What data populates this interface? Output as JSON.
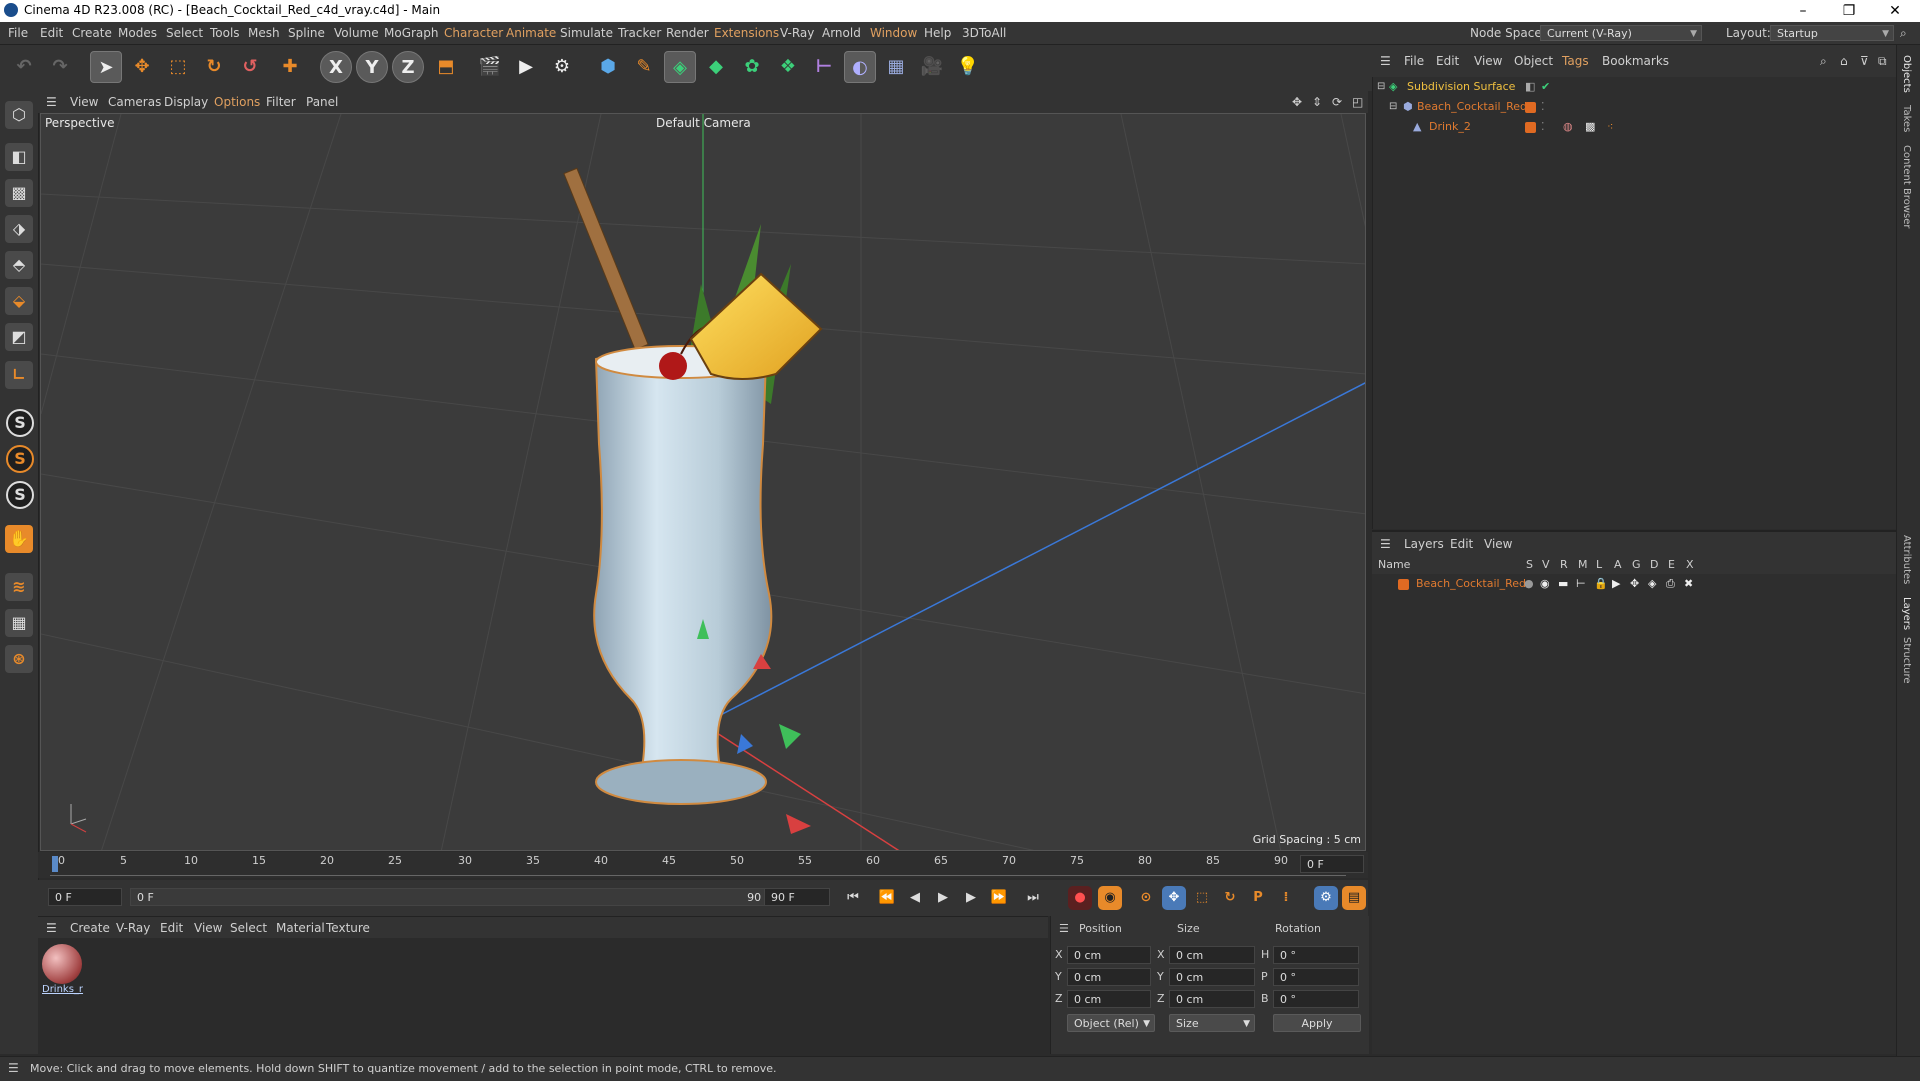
{
  "window": {
    "title": "Cinema 4D R23.008 (RC) - [Beach_Cocktail_Red_c4d_vray.c4d] - Main",
    "minimize": "–",
    "maximize": "❐",
    "close": "✕"
  },
  "menubar": {
    "items": [
      "File",
      "Edit",
      "Create",
      "Modes",
      "Select",
      "Tools",
      "Mesh",
      "Spline",
      "Volume",
      "MoGraph",
      "Character",
      "Animate",
      "Simulate",
      "Tracker",
      "Render",
      "Extensions",
      "V-Ray",
      "Arnold",
      "Window",
      "Help",
      "3DToAll"
    ],
    "node_space_label": "Node Space:",
    "node_space_value": "Current (V-Ray)",
    "layout_label": "Layout:",
    "layout_value": "Startup"
  },
  "toolbar": {
    "axis_x": "X",
    "axis_y": "Y",
    "axis_z": "Z"
  },
  "viewport": {
    "menu": [
      "View",
      "Cameras",
      "Display",
      "Options",
      "Filter",
      "Panel"
    ],
    "label": "Perspective",
    "camera": "Default Camera",
    "grid_spacing": "Grid Spacing : 5 cm"
  },
  "timeline": {
    "ticks": [
      "0",
      "5",
      "10",
      "15",
      "20",
      "25",
      "30",
      "35",
      "40",
      "45",
      "50",
      "55",
      "60",
      "65",
      "70",
      "75",
      "80",
      "85",
      "90"
    ],
    "current_frame": "0 F",
    "start_frame": "0 F",
    "slider_start": "0 F",
    "slider_end": "90 F",
    "end_frame": "90 F"
  },
  "material": {
    "menu": [
      "Create",
      "V-Ray",
      "Edit",
      "View",
      "Select",
      "Material",
      "Texture"
    ],
    "swatch_label": "Drinks_r"
  },
  "coords": {
    "headers": {
      "position": "Position",
      "size": "Size",
      "rotation": "Rotation"
    },
    "rows": [
      {
        "axis": "X",
        "pos": "0 cm",
        "size_axis": "X",
        "size": "0 cm",
        "rot_axis": "H",
        "rot": "0 °"
      },
      {
        "axis": "Y",
        "pos": "0 cm",
        "size_axis": "Y",
        "size": "0 cm",
        "rot_axis": "P",
        "rot": "0 °"
      },
      {
        "axis": "Z",
        "pos": "0 cm",
        "size_axis": "Z",
        "size": "0 cm",
        "rot_axis": "B",
        "rot": "0 °"
      }
    ],
    "mode": "Object (Rel)",
    "size_mode": "Size",
    "apply": "Apply"
  },
  "objects": {
    "menu": [
      "File",
      "Edit",
      "View",
      "Object",
      "Tags",
      "Bookmarks"
    ],
    "items": [
      {
        "name": "Subdivision Surface",
        "color": "#f0c040"
      },
      {
        "name": "Beach_Cocktail_Red",
        "color": "#e07a30"
      },
      {
        "name": "Drink_2",
        "color": "#e07a30"
      }
    ]
  },
  "layers": {
    "menu": [
      "Layers",
      "Edit",
      "View"
    ],
    "columns": [
      "Name",
      "S",
      "V",
      "R",
      "M",
      "L",
      "A",
      "G",
      "D",
      "E",
      "X"
    ],
    "items": [
      {
        "name": "Beach_Cocktail_Red"
      }
    ]
  },
  "side_tabs": [
    "Objects",
    "Takes",
    "Content Browser",
    "Attributes",
    "Layers",
    "Structure"
  ],
  "status": "Move: Click and drag to move elements. Hold down SHIFT to quantize movement / add to the selection in point mode, CTRL to remove.",
  "colors": {
    "accent": "#e88a2a",
    "selected_tab": "#e0a060"
  }
}
